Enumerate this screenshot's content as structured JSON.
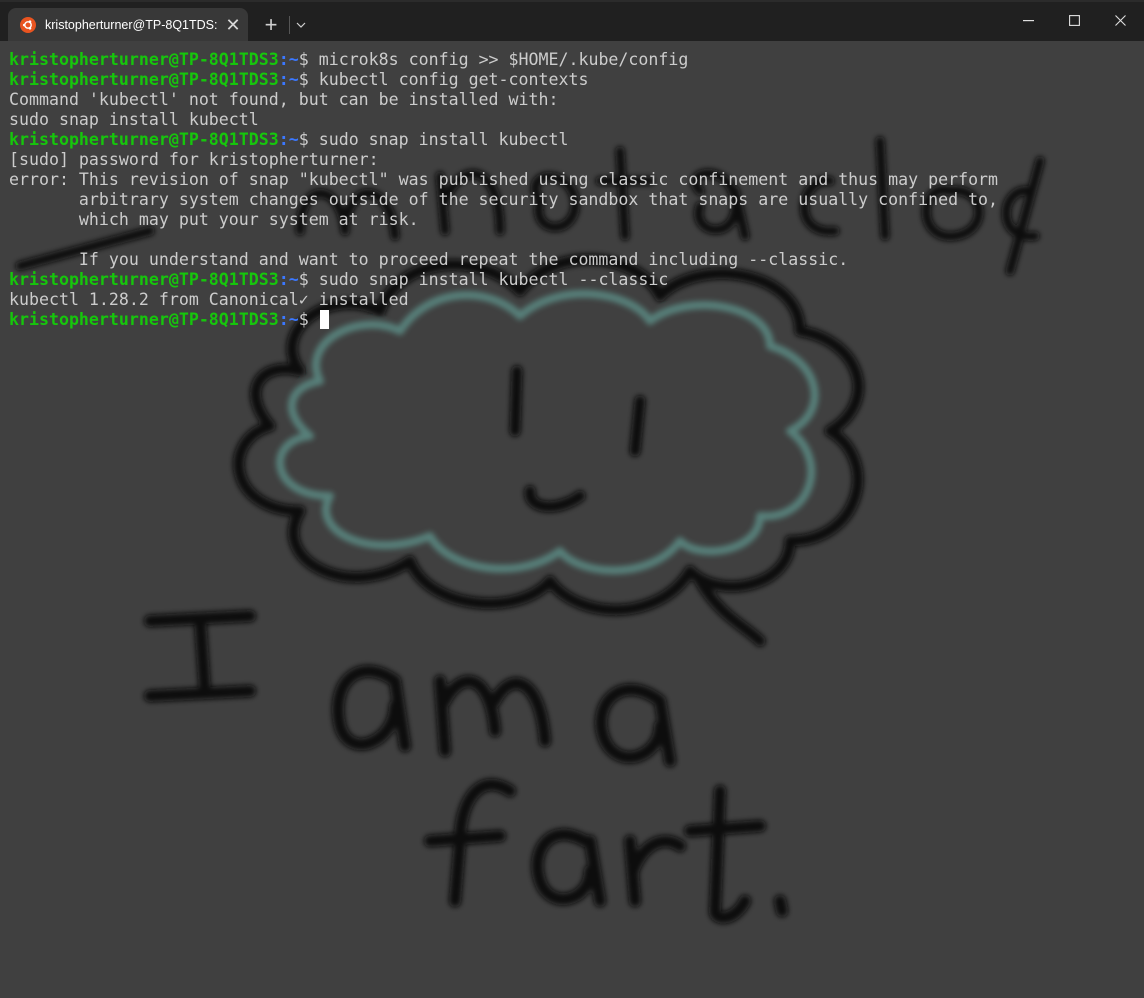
{
  "window": {
    "tab_title": "kristopherturner@TP-8Q1TDS:",
    "tab_icon": "ubuntu-icon",
    "close_tab_glyph": "✕",
    "new_tab_glyph": "+"
  },
  "terminal": {
    "prompt_user": "kristopherturner@TP-8Q1TDS3",
    "prompt_path": ":~",
    "prompt_symbol": "$ ",
    "colors": {
      "prompt": "#16c60c",
      "path": "#3b78ff",
      "text": "#cccccc",
      "background": "#404040"
    },
    "lines": [
      {
        "type": "cmd",
        "text": "microk8s config >> $HOME/.kube/config"
      },
      {
        "type": "cmd",
        "text": "kubectl config get-contexts"
      },
      {
        "type": "out",
        "text": "Command 'kubectl' not found, but can be installed with:"
      },
      {
        "type": "out",
        "text": "sudo snap install kubectl"
      },
      {
        "type": "cmd",
        "text": "sudo snap install kubectl"
      },
      {
        "type": "out",
        "text": "[sudo] password for kristopherturner:"
      },
      {
        "type": "out",
        "text": "error: This revision of snap \"kubectl\" was published using classic confinement and thus may perform"
      },
      {
        "type": "out",
        "text": "       arbitrary system changes outside of the security sandbox that snaps are usually confined to,"
      },
      {
        "type": "out",
        "text": "       which may put your system at risk."
      },
      {
        "type": "out",
        "text": ""
      },
      {
        "type": "out",
        "text": "       If you understand and want to proceed repeat the command including --classic."
      },
      {
        "type": "cmd",
        "text": "sudo snap install kubectl --classic"
      },
      {
        "type": "out",
        "text": "kubectl 1.28.2 from Canonical✓ installed"
      },
      {
        "type": "cmd",
        "text": ""
      }
    ]
  },
  "background_art": {
    "handwriting_top": "i'm not a cloud",
    "handwriting_bottom": "I am a fart."
  }
}
